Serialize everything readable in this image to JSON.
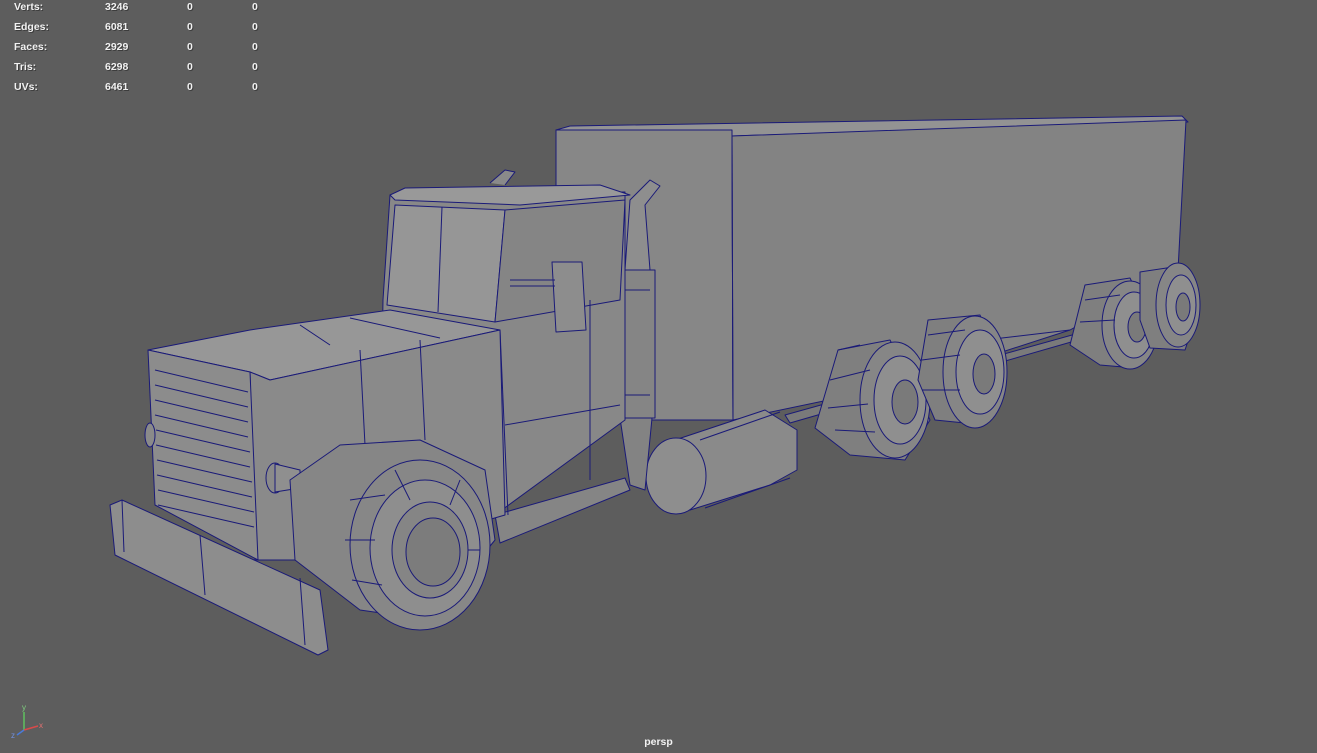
{
  "hud": {
    "rows": [
      {
        "label": "Verts:",
        "total": "3246",
        "selected": "0",
        "component": "0"
      },
      {
        "label": "Edges:",
        "total": "6081",
        "selected": "0",
        "component": "0"
      },
      {
        "label": "Faces:",
        "total": "2929",
        "selected": "0",
        "component": "0"
      },
      {
        "label": "Tris:",
        "total": "6298",
        "selected": "0",
        "component": "0"
      },
      {
        "label": "UVs:",
        "total": "6461",
        "selected": "0",
        "component": "0"
      }
    ]
  },
  "viewport": {
    "camera": "persp",
    "background": "#5d5d5d",
    "wire_color": "#1a1a78",
    "surface_color": "#8a8a8a"
  },
  "axis_gizmo": {
    "x": "x",
    "y": "y",
    "z": "z"
  }
}
